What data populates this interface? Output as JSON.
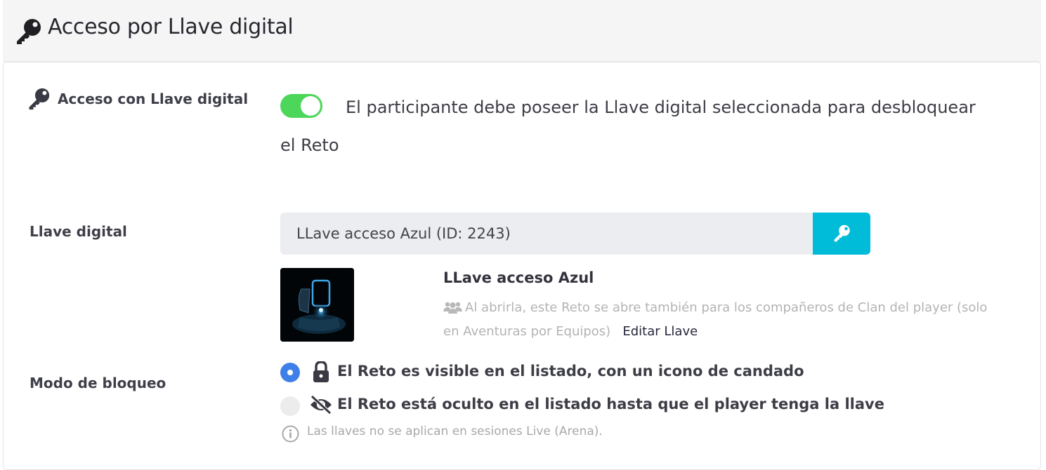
{
  "header": {
    "title": "Acceso por Llave digital",
    "icon": "key-icon"
  },
  "access": {
    "label": "Acceso con Llave digital",
    "toggle_on": true,
    "description_line1": "El participante debe poseer la Llave digital seleccionada para desbloquear",
    "description_line2": "el Reto"
  },
  "key": {
    "label": "Llave digital",
    "value": "LLave acceso Azul (ID: 2243)",
    "button_icon": "key-icon",
    "name": "LLave acceso Azul",
    "clan_note_line1": "Al abrirla, este Reto se abre también para los compañeros de Clan del player (solo",
    "clan_note_line2": "en Aventuras por Equipos)",
    "edit_label": "Editar Llave"
  },
  "lock_mode": {
    "label": "Modo de bloqueo",
    "options": [
      {
        "label": "El Reto es visible en el listado, con un icono de candado",
        "selected": true,
        "icon": "lock-icon"
      },
      {
        "label": "El Reto está oculto en el listado hasta que el player tenga la llave",
        "selected": false,
        "icon": "eye-slash-icon"
      }
    ],
    "note": "Las llaves no se aplican en sesiones Live (Arena)."
  },
  "colors": {
    "toggle": "#4cd65a",
    "key_button": "#00bcd9",
    "radio_selected": "#3f7fe8"
  }
}
